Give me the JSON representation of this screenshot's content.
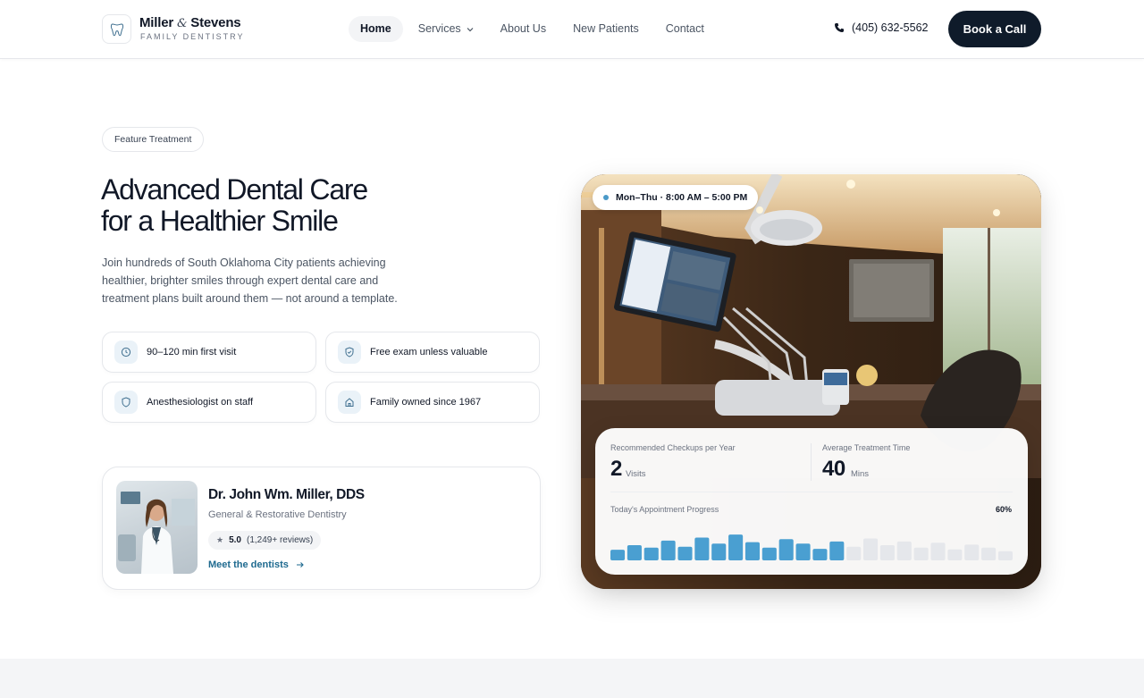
{
  "brand": {
    "name_a": "Miller",
    "amp": "&",
    "name_b": "Stevens",
    "subtitle": "FAMILY DENTISTRY",
    "logo_icon": "tooth-icon"
  },
  "nav": {
    "items": [
      {
        "label": "Home",
        "active": true
      },
      {
        "label": "Services",
        "has_dropdown": true
      },
      {
        "label": "About Us"
      },
      {
        "label": "New Patients"
      },
      {
        "label": "Contact"
      }
    ]
  },
  "header": {
    "phone": "(405) 632-5562",
    "book_label": "Book a Call"
  },
  "hero": {
    "tag": "Feature Treatment",
    "title_line1": "Advanced Dental Care",
    "title_line2": "for a Healthier Smile",
    "description": "Join hundreds of South Oklahoma City patients achieving healthier, brighter smiles through expert dental care and treatment plans built around them — not around a template.",
    "features": [
      {
        "label": "90–120 min first visit",
        "icon": "clock-icon"
      },
      {
        "label": "Free exam unless valuable",
        "icon": "shield-check-icon"
      },
      {
        "label": "Anesthesiologist on staff",
        "icon": "heart-shield-icon"
      },
      {
        "label": "Family owned since 1967",
        "icon": "home-icon"
      }
    ]
  },
  "doctor": {
    "name": "Dr. John Wm. Miller, DDS",
    "role": "General & Restorative Dentistry",
    "rating": "5.0",
    "reviews": "(1,249+ reviews)",
    "link": "Meet the dentists"
  },
  "office": {
    "hours": "Mon–Thu · 8:00 AM – 5:00 PM",
    "stat1_label": "Recommended Checkups per Year",
    "stat1_value": "2",
    "stat1_unit": "Visits",
    "stat2_label": "Average Treatment Time",
    "stat2_value": "40",
    "stat2_unit": "Mins",
    "progress_label": "Today's Appointment Progress",
    "progress_value": "60%",
    "progress_fraction": 0.6,
    "bar_levels": [
      0.35,
      0.5,
      0.42,
      0.65,
      0.45,
      0.75,
      0.55,
      0.85,
      0.6,
      0.42,
      0.7,
      0.55,
      0.38,
      0.62,
      0.45,
      0.72,
      0.5,
      0.62,
      0.42,
      0.58,
      0.36,
      0.52,
      0.42,
      0.3
    ],
    "colors": {
      "active": "#4a9fd1",
      "inactive": "#e5e7eb"
    }
  }
}
